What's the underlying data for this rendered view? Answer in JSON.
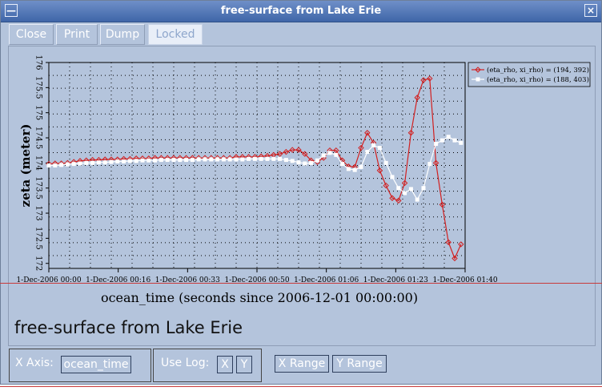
{
  "window": {
    "title": "free-surface from Lake Erie",
    "menu_glyph": "—",
    "close_glyph": "×"
  },
  "toolbar": {
    "close": "Close",
    "print": "Print",
    "dump": "Dump",
    "locked": "Locked"
  },
  "plot_title": "free-surface from Lake Erie",
  "chart_data": {
    "type": "line",
    "xlabel": "ocean_time (seconds since 2006-12-01 00:00:00)",
    "ylabel": "zeta (meter)",
    "x_tick_labels": [
      "1-Dec-2006 00:00",
      "1-Dec-2006 00:16",
      "1-Dec-2006 00:33",
      "1-Dec-2006 00:50",
      "1-Dec-2006 01:06",
      "1-Dec-2006 01:23",
      "1-Dec-2006 01:40"
    ],
    "y_tick_labels": [
      "172",
      "172.5",
      "173",
      "173.5",
      "174",
      "174.5",
      "175",
      "175.5",
      "176"
    ],
    "ylim": [
      171.9,
      176
    ],
    "xlim_minutes": [
      0,
      100
    ],
    "x_unit": "minutes after 2006-12-01 00:00",
    "grid": true,
    "legend_position": "top-right",
    "series": [
      {
        "name": "(eta_rho, xi_rho) = (194, 392)",
        "color": "#d22020",
        "x": [
          0,
          1.5,
          3,
          4.5,
          6,
          7.5,
          9,
          10.5,
          12,
          13.5,
          15,
          16.5,
          18,
          19.5,
          21,
          22.5,
          24,
          25.5,
          27,
          28.5,
          30,
          31.5,
          33,
          34.5,
          36,
          37.5,
          39,
          40.5,
          42,
          43.5,
          45,
          46.5,
          48,
          49.5,
          51,
          52.5,
          54,
          55.5,
          57,
          58.5,
          60,
          61.5,
          63,
          64.5,
          66,
          67.5,
          69,
          70.5,
          72,
          73.5,
          75,
          76.5,
          78,
          79.5,
          81,
          82.5,
          84,
          85.5,
          87,
          88.5,
          90,
          91.5,
          93,
          94.5
        ],
        "y": [
          173.98,
          173.99,
          173.99,
          174,
          174.02,
          174.04,
          174.05,
          174.06,
          174.06,
          174.07,
          174.07,
          174.07,
          174.08,
          174.08,
          174.09,
          174.09,
          174.09,
          174.1,
          174.1,
          174.1,
          174.1,
          174.1,
          174.1,
          174.1,
          174.1,
          174.1,
          174.1,
          174.1,
          174.1,
          174.1,
          174.12,
          174.12,
          174.12,
          174.12,
          174.13,
          174.14,
          174.16,
          174.18,
          174.22,
          174.26,
          174.26,
          174.18,
          174.05,
          174.02,
          174.1,
          174.25,
          174.25,
          174.05,
          173.93,
          173.92,
          174.3,
          174.6,
          174.4,
          173.85,
          173.55,
          173.3,
          173.25,
          173.6,
          174.6,
          175.3,
          175.65,
          175.68,
          174.0,
          173.17
        ]
      },
      {
        "name": "(eta_rho, xi_rho) = (188, 403)",
        "color": "#ffffff",
        "x": [
          0,
          1.5,
          3,
          4.5,
          6,
          7.5,
          9,
          10.5,
          12,
          13.5,
          15,
          16.5,
          18,
          19.5,
          21,
          22.5,
          24,
          25.5,
          27,
          28.5,
          30,
          31.5,
          33,
          34.5,
          36,
          37.5,
          39,
          40.5,
          42,
          43.5,
          45,
          46.5,
          48,
          49.5,
          51,
          52.5,
          54,
          55.5,
          57,
          58.5,
          60,
          61.5,
          63,
          64.5,
          66,
          67.5,
          69,
          70.5,
          72,
          73.5,
          75,
          76.5,
          78,
          79.5,
          81,
          82.5,
          84,
          85.5,
          87,
          88.5,
          90,
          91.5,
          93,
          94.5
        ],
        "y": [
          173.95,
          173.95,
          173.96,
          173.97,
          173.98,
          173.99,
          174,
          174,
          174.01,
          174.01,
          174.02,
          174.03,
          174.03,
          174.04,
          174.04,
          174.05,
          174.05,
          174.05,
          174.06,
          174.06,
          174.06,
          174.06,
          174.06,
          174.06,
          174.07,
          174.07,
          174.07,
          174.07,
          174.07,
          174.07,
          174.07,
          174.07,
          174.08,
          174.08,
          174.08,
          174.08,
          174.08,
          174.08,
          174.06,
          174.04,
          174.01,
          173.99,
          174.0,
          174.05,
          174.15,
          174.2,
          174.16,
          173.98,
          173.88,
          173.86,
          173.92,
          174.22,
          174.35,
          174.3,
          174.0,
          173.72,
          173.5,
          173.4,
          173.48,
          173.27,
          173.5,
          173.98,
          174.38,
          174.45
        ]
      }
    ]
  },
  "extra_red_points": {
    "x": [
      96,
      97.5,
      99
    ],
    "y": [
      172.42,
      172.1,
      172.38
    ]
  },
  "extra_white_points": {
    "x": [
      96,
      97.5,
      99
    ],
    "y": [
      174.52,
      174.45,
      174.4
    ]
  },
  "bottom": {
    "xaxis_label": "X Axis:",
    "xaxis_value": "ocean_time",
    "uselog_label": "Use Log:",
    "log_x": "X",
    "log_y": "Y",
    "x_range": "X Range",
    "y_range": "Y Range"
  }
}
